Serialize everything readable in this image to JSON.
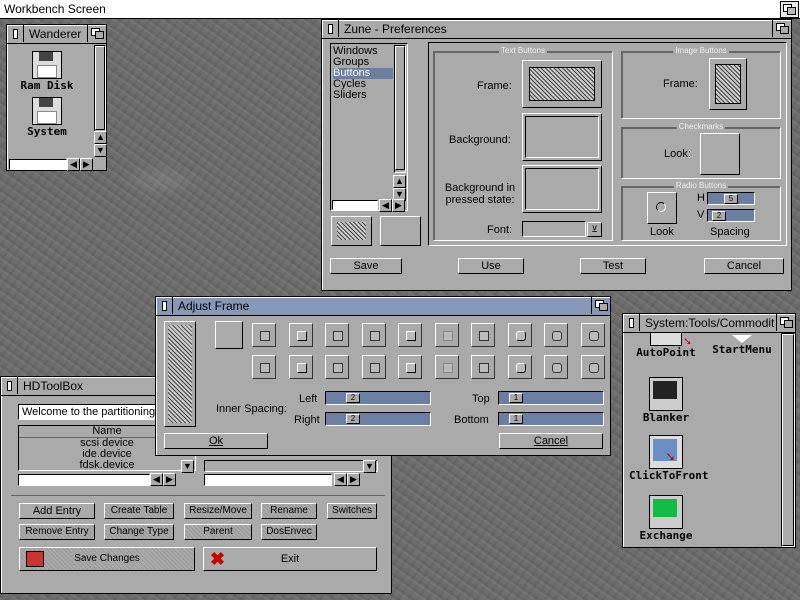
{
  "screen": {
    "title": "Workbench Screen"
  },
  "wanderer": {
    "title": "Wanderer",
    "icons": [
      "Ram Disk",
      "System"
    ]
  },
  "prefs": {
    "title": "Zune - Preferences",
    "list": [
      "Windows",
      "Groups",
      "Buttons",
      "Cycles",
      "Sliders"
    ],
    "selected_index": 2,
    "text_buttons": {
      "header": "Text Buttons",
      "frame": "Frame:",
      "background": "Background:",
      "pressed": "Background in pressed state:",
      "font": "Font:"
    },
    "image_buttons": {
      "header": "Image Buttons",
      "frame": "Frame:"
    },
    "checkmarks": {
      "header": "Checkmarks",
      "look": "Look:"
    },
    "radio": {
      "header": "Radio Buttons",
      "look": "Look",
      "h_label": "H",
      "h_value": "5",
      "v_label": "V",
      "v_value": "2",
      "spacing": "Spacing"
    },
    "buttons": {
      "save": "Save",
      "use": "Use",
      "test": "Test",
      "cancel": "Cancel"
    }
  },
  "adjust": {
    "title": "Adjust Frame",
    "inner_spacing": "Inner Spacing:",
    "left_label": "Left",
    "left_value": "2",
    "right_label": "Right",
    "right_value": "2",
    "top_label": "Top",
    "top_value": "1",
    "bottom_label": "Bottom",
    "bottom_value": "1",
    "ok": "Ok",
    "cancel": "Cancel"
  },
  "hdtoolbox": {
    "title": "HDToolBox",
    "welcome": "Welcome to the partitioning",
    "column_name": "Name",
    "devices": [
      "scsi.device",
      "ide.device",
      "fdsk.device"
    ],
    "buttons": {
      "add_entry": "Add Entry",
      "create_table": "Create Table",
      "resize_move": "Resize/Move",
      "rename": "Rename",
      "switches": "Switches",
      "remove_entry": "Remove Entry",
      "change_type": "Change Type",
      "parent": "Parent",
      "dosenvec": "DosEnvec",
      "save_changes": "Save Changes",
      "exit": "Exit"
    }
  },
  "commodities": {
    "title": "System:Tools/Commoditie",
    "icons": [
      "AutoPoint",
      "StartMenu",
      "Blanker",
      "ClickToFront",
      "Exchange"
    ]
  }
}
